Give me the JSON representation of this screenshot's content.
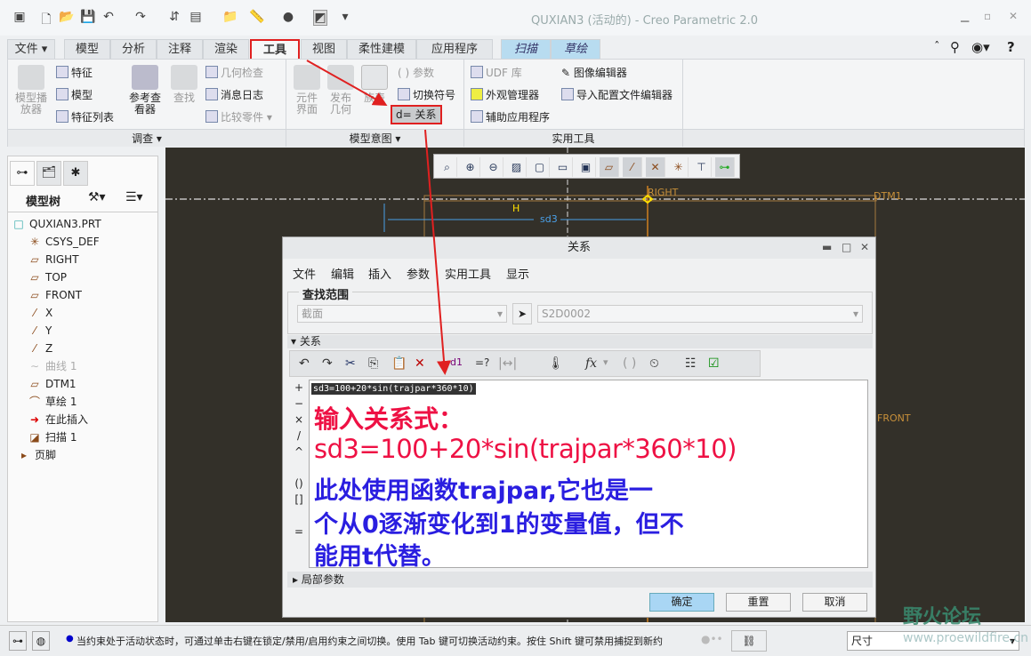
{
  "window": {
    "title": "QUXIAN3 (活动的) - Creo Parametric 2.0",
    "icons": [
      "app-icon",
      "new-icon",
      "open-icon",
      "save-icon",
      "undo-icon",
      "redo-icon",
      "regenerate-icon",
      "windows-icon",
      "folder-icon",
      "measure-icon",
      "appearance-icon",
      "sketch-display-icon"
    ]
  },
  "tabs": [
    {
      "label": "文件 ▾"
    },
    {
      "label": "模型"
    },
    {
      "label": "分析"
    },
    {
      "label": "注释"
    },
    {
      "label": "渲染"
    },
    {
      "label": "工具",
      "active": true
    },
    {
      "label": "视图"
    },
    {
      "label": "柔性建模"
    },
    {
      "label": "应用程序"
    },
    {
      "label": "扫描"
    },
    {
      "label": "草绘"
    }
  ],
  "ribbon": {
    "investigate": {
      "label": "调查 ▾",
      "model_player": "模型播\n放器",
      "feature": "特征",
      "model": "模型",
      "feature_list": "特征列表",
      "ref_viewer": "参考查\n看器",
      "find": "查找",
      "geom_check": "几何检查",
      "msg_log": "消息日志",
      "compare": "比较零件 ▾"
    },
    "model_intent": {
      "label": "模型意图 ▾",
      "component_interface": "元件\n界面",
      "publish_geom": "发布\n几何",
      "family_table": "族表",
      "parameters": "参数",
      "switch_symbols": "切换符号",
      "relations": "d= 关系"
    },
    "utilities": {
      "label": "实用工具",
      "udf": "UDF 库",
      "appearance_mgr": "外观管理器",
      "aux_apps": "辅助应用程序",
      "image_editor": "图像编辑器",
      "config_editor": "导入配置文件编辑器"
    }
  },
  "model_tree": {
    "title": "模型树",
    "items": [
      {
        "label": "QUXIAN3.PRT",
        "icon": "□"
      },
      {
        "label": "CSYS_DEF",
        "icon": "✳"
      },
      {
        "label": "RIGHT",
        "icon": "▱"
      },
      {
        "label": "TOP",
        "icon": "▱"
      },
      {
        "label": "FRONT",
        "icon": "▱"
      },
      {
        "label": "X",
        "icon": "⁄"
      },
      {
        "label": "Y",
        "icon": "⁄"
      },
      {
        "label": "Z",
        "icon": "⁄"
      },
      {
        "label": "曲线 1",
        "icon": "∼"
      },
      {
        "label": "DTM1",
        "icon": "▱"
      },
      {
        "label": "草绘 1",
        "icon": "⌒"
      },
      {
        "label": "在此插入",
        "icon": "➜"
      },
      {
        "label": "扫描 1",
        "icon": "◪"
      },
      {
        "label": "页脚",
        "icon": "▸"
      }
    ]
  },
  "canvas": {
    "labels": {
      "right": "RIGHT",
      "dtm1": "DTM1",
      "h": "H",
      "sd3": "sd3",
      "front": "FRONT"
    }
  },
  "dialog": {
    "title": "关系",
    "menu": [
      "文件",
      "编辑",
      "插入",
      "参数",
      "实用工具",
      "显示"
    ],
    "scope_label": "查找范围",
    "scope_type": "截面",
    "scope_value": "S2D0002",
    "relations_label": "关系",
    "operators": [
      "+",
      "−",
      "×",
      "/",
      "^",
      "()",
      "[]",
      "="
    ],
    "code": "sd3=100+20*sin(trajpar*360*10)",
    "note_line1": "输入关系式：",
    "note_line2": "sd3=100+20*sin(trajpar*360*10)",
    "note_line3": "此处使用函数trajpar,它也是一",
    "note_line4": "个从0逐渐变化到1的变量值，但不",
    "note_line5": "能用t代替。",
    "local_params": "局部参数",
    "ok": "确定",
    "reset": "重置",
    "cancel": "取消"
  },
  "status": {
    "message": "当约束处于活动状态时，可通过单击右键在锁定/禁用/启用约束之间切换。使用 Tab 键可切换活动约束。按住 Shift 键可禁用捕捉到新约!",
    "filter": "尺寸"
  },
  "watermark": {
    "title": "野火论坛",
    "url": "www.proewildfire.cn"
  },
  "colors": {
    "highlight": "#e02020",
    "note_red": "#ee1144",
    "note_blue": "#2a1ee0",
    "canvas": "#333029"
  }
}
